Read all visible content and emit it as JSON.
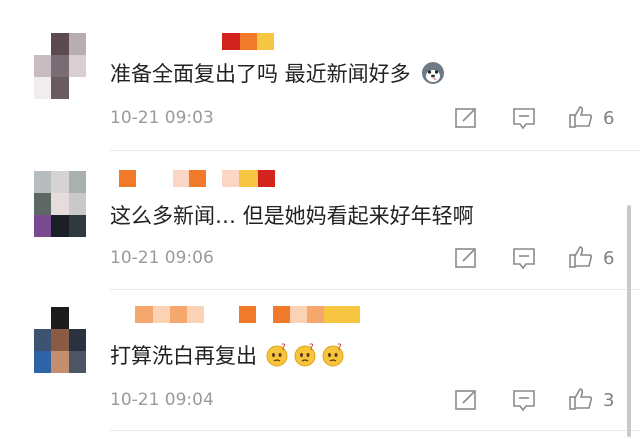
{
  "comments": [
    {
      "text": "准备全面复出了吗 最近新闻好多",
      "emojis": [
        "husky-emoji"
      ],
      "time": "10-21 09:03",
      "likes": "6"
    },
    {
      "text": "这么多新闻… 但是她妈看起来好年轻啊",
      "emojis": [],
      "time": "10-21 09:06",
      "likes": "6"
    },
    {
      "text": "打算洗白再复出",
      "emojis": [
        "thinking-face-emoji",
        "thinking-face-emoji",
        "thinking-face-emoji"
      ],
      "time": "10-21 09:04",
      "likes": "3"
    }
  ],
  "icons": {
    "edit": "edit-icon",
    "reply": "comment-icon",
    "like": "thumbs-up-icon"
  },
  "colors": {
    "text": "#222222",
    "meta": "#9a9a9a",
    "icon": "#8a8a8a",
    "mosaic_red": "#d2231e",
    "mosaic_orange": "#f07a2a",
    "mosaic_yellow": "#f6c542"
  }
}
